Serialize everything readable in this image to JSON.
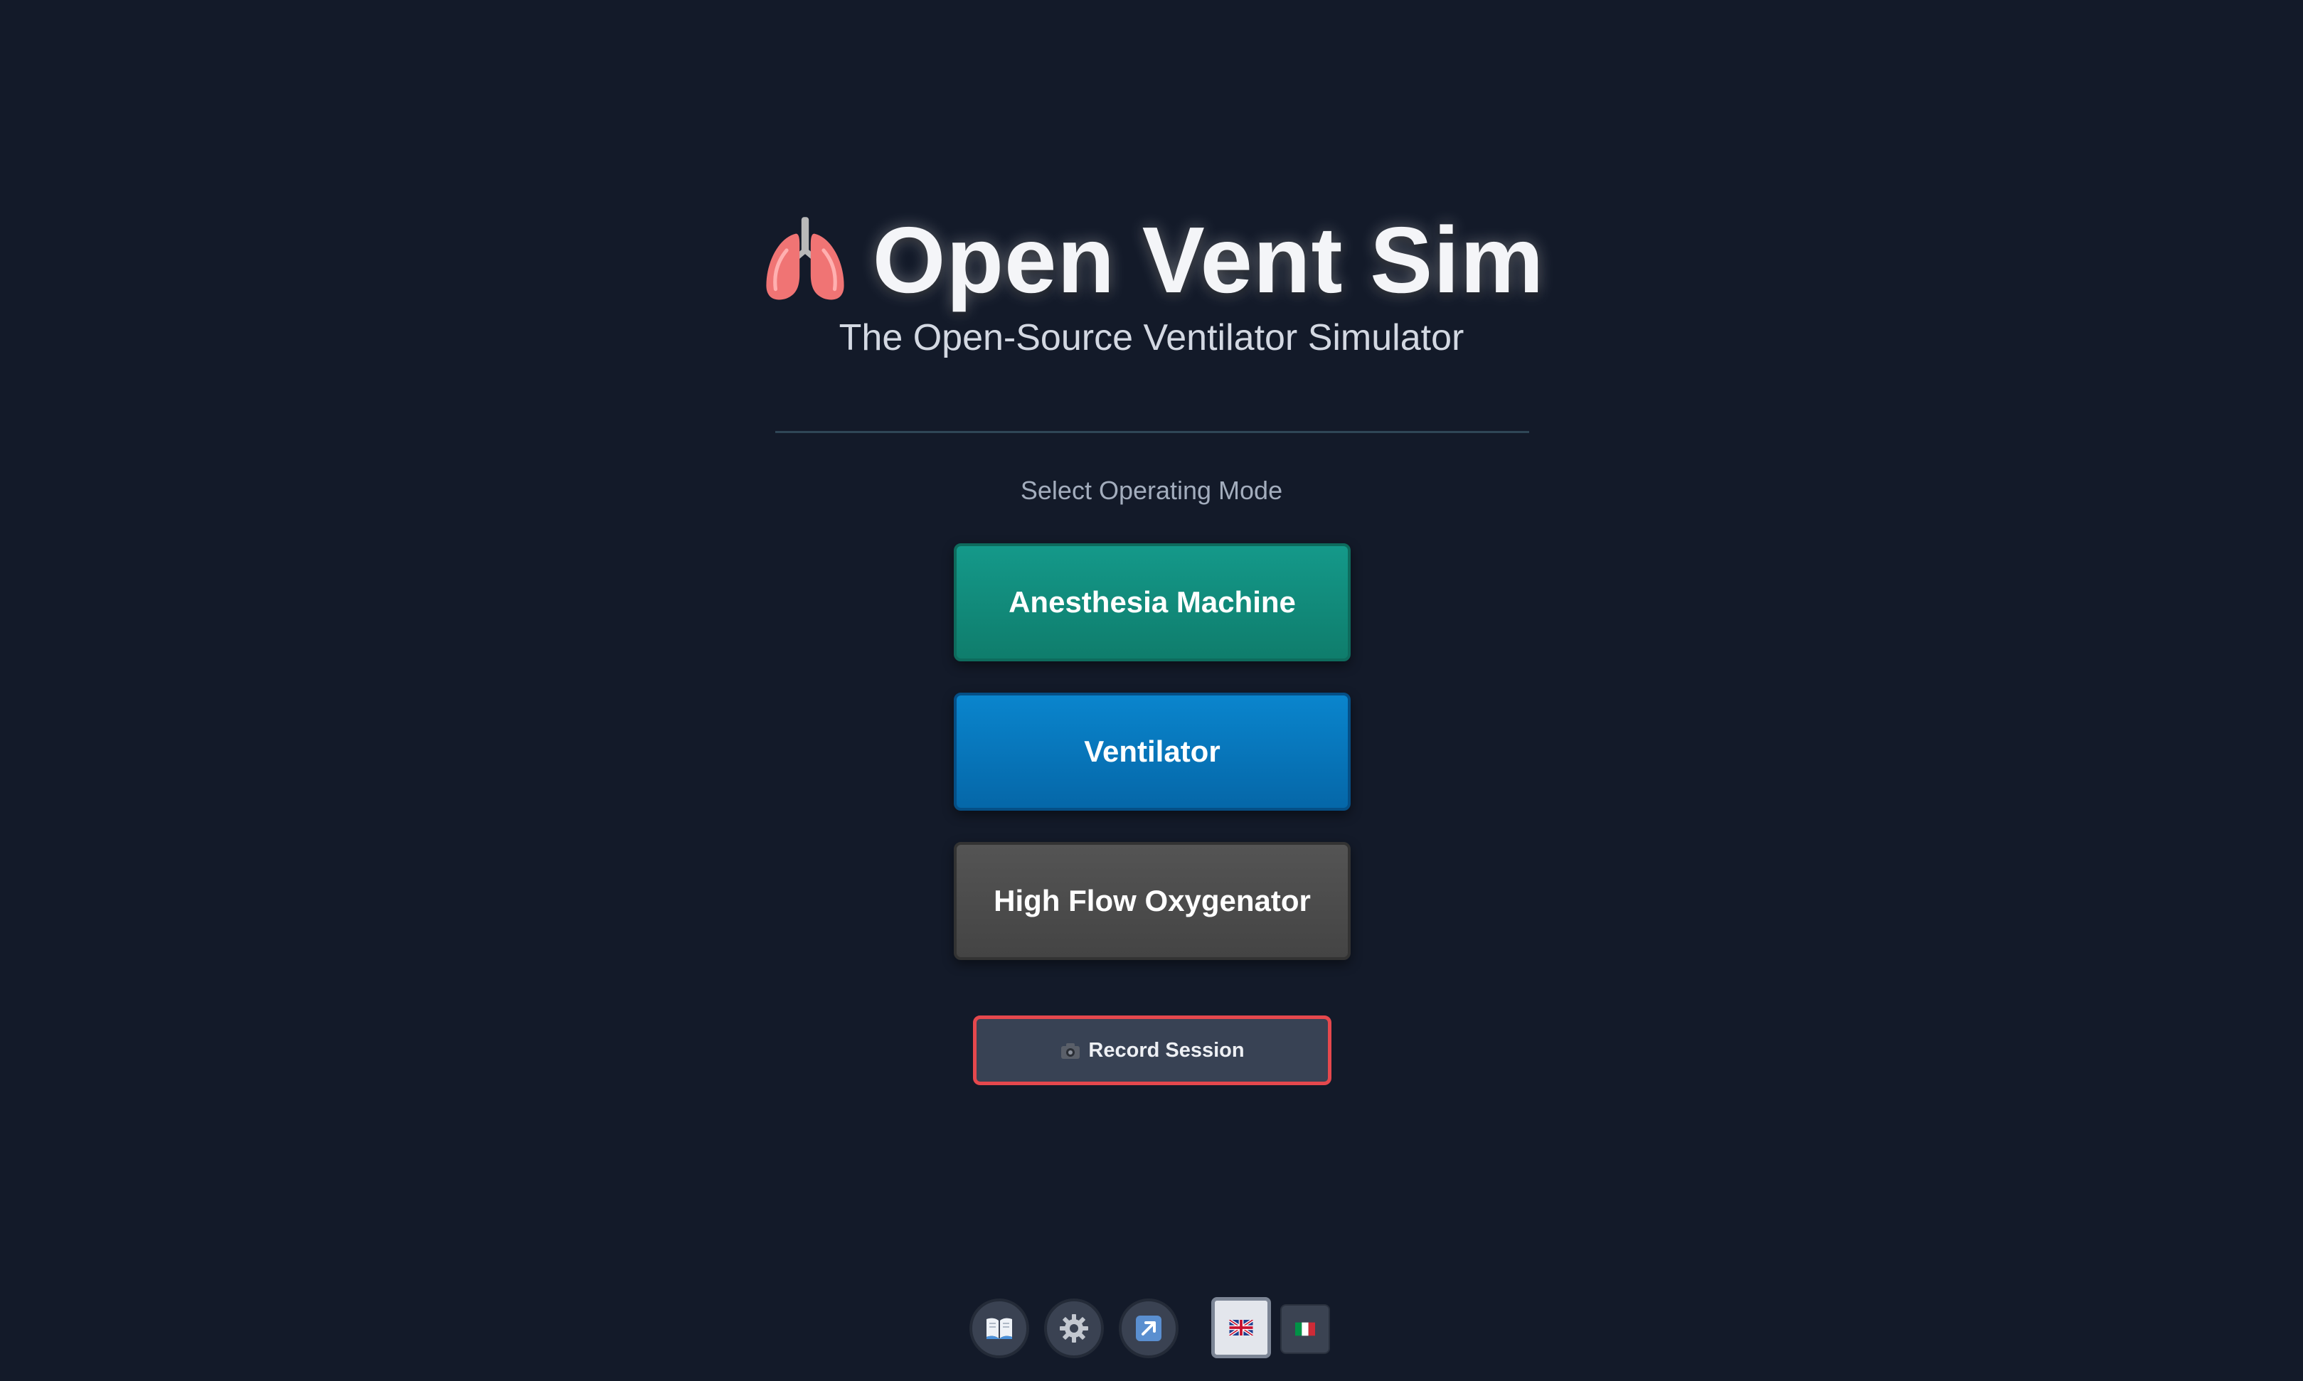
{
  "header": {
    "title": "Open Vent Sim",
    "icon": "lungs-icon",
    "subtitle": "The Open-Source Ventilator Simulator"
  },
  "mode_selection": {
    "label": "Select Operating Mode",
    "modes": [
      {
        "label": "Anesthesia Machine",
        "color": "#14998a"
      },
      {
        "label": "Ventilator",
        "color": "#0a85cd"
      },
      {
        "label": "High Flow Oxygenator",
        "color": "#545454"
      }
    ]
  },
  "record": {
    "label": "Record Session",
    "icon": "camera-icon",
    "border_color": "#e5484d"
  },
  "toolbar": {
    "buttons": [
      {
        "icon": "book-icon"
      },
      {
        "icon": "gear-icon"
      },
      {
        "icon": "external-link-icon"
      }
    ],
    "languages": [
      {
        "code": "en",
        "icon": "uk-flag-icon",
        "selected": true
      },
      {
        "code": "it",
        "icon": "italy-flag-icon",
        "selected": false
      }
    ]
  },
  "theme": {
    "background": "#131a29"
  }
}
